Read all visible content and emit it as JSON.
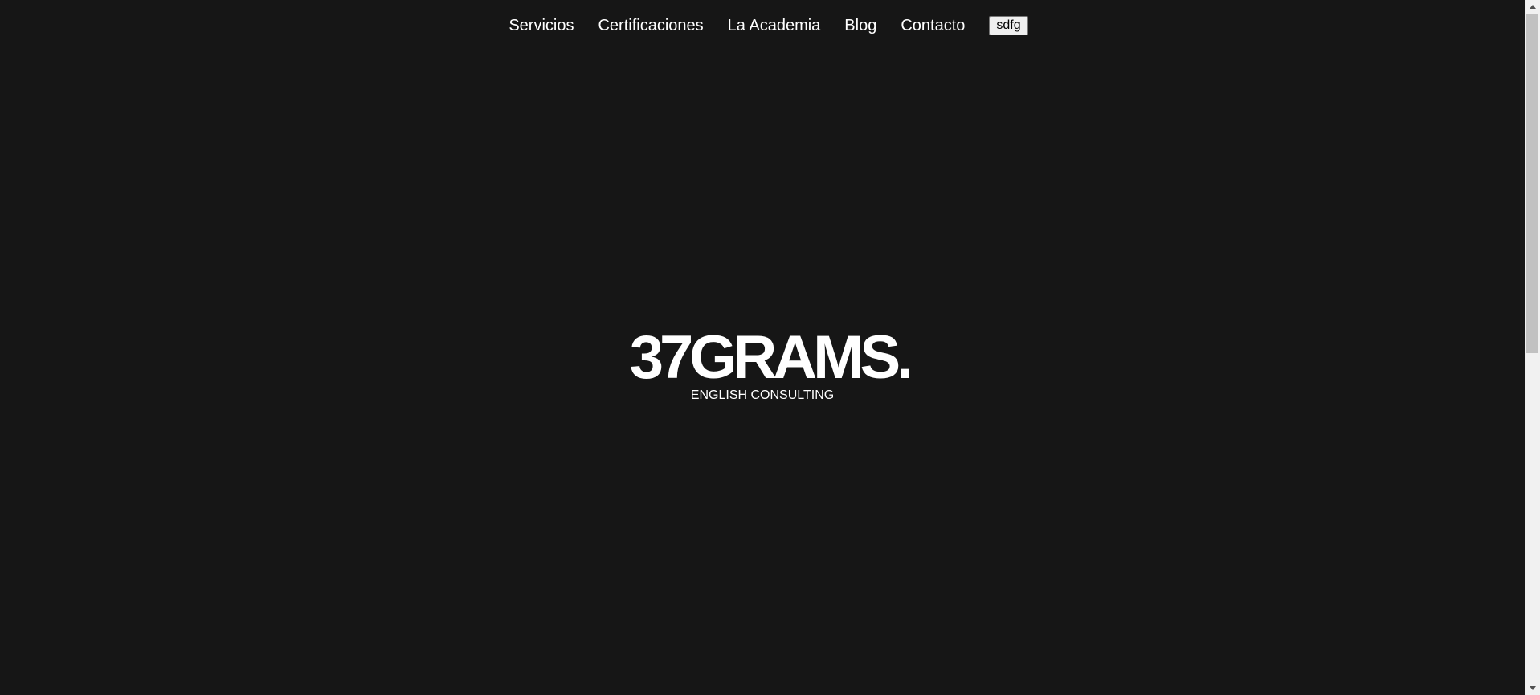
{
  "nav": {
    "items": [
      {
        "label": "Servicios"
      },
      {
        "label": "Certificaciones"
      },
      {
        "label": "La Academia"
      },
      {
        "label": "Blog"
      },
      {
        "label": "Contacto"
      }
    ],
    "button_label": "sdfg"
  },
  "hero": {
    "logo": "37GRAMS.",
    "tagline": "ENGLISH CONSULTING"
  },
  "colors": {
    "background": "#161616",
    "text": "#ffffff"
  }
}
